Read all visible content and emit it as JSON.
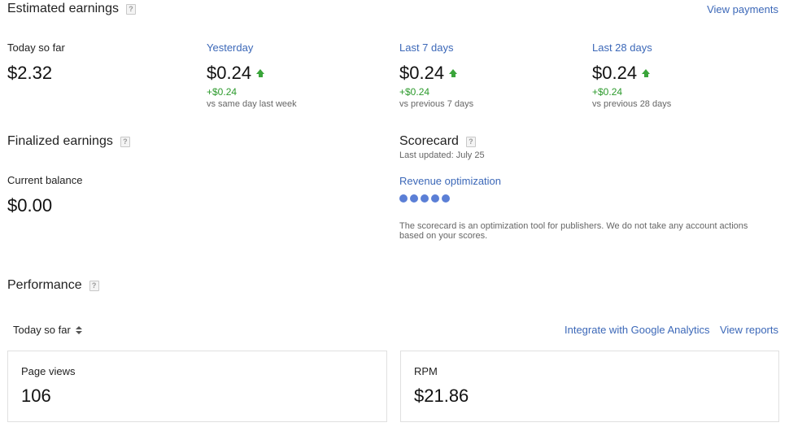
{
  "estimated": {
    "title": "Estimated earnings",
    "view_payments": "View payments",
    "today": {
      "label": "Today so far",
      "value": "$2.32"
    },
    "yesterday": {
      "label": "Yesterday",
      "value": "$0.24",
      "delta": "+$0.24",
      "compare": "vs same day last week"
    },
    "last7": {
      "label": "Last 7 days",
      "value": "$0.24",
      "delta": "+$0.24",
      "compare": "vs previous 7 days"
    },
    "last28": {
      "label": "Last 28 days",
      "value": "$0.24",
      "delta": "+$0.24",
      "compare": "vs previous 28 days"
    }
  },
  "finalized": {
    "title": "Finalized earnings",
    "balance_label": "Current balance",
    "balance_value": "$0.00"
  },
  "scorecard": {
    "title": "Scorecard",
    "updated": "Last updated: July 25",
    "revenue_label": "Revenue optimization",
    "dots": 5,
    "note": "The scorecard is an optimization tool for publishers. We do not take any account actions based on your scores."
  },
  "performance": {
    "title": "Performance",
    "range": "Today so far",
    "integrate_link": "Integrate with Google Analytics",
    "reports_link": "View reports",
    "page_views": {
      "label": "Page views",
      "value": "106"
    },
    "rpm": {
      "label": "RPM",
      "value": "$21.86"
    }
  },
  "help_icon": "?",
  "colors": {
    "link": "#3c68b8",
    "positive": "#2c9a2c",
    "dot": "#5b7fd6"
  }
}
